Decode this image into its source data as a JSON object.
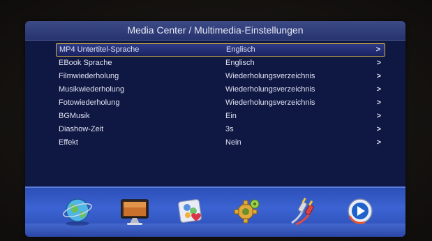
{
  "title": "Media Center / Multimedia-Einstellungen",
  "settings": [
    {
      "label": "MP4 Untertitel-Sprache",
      "value": "Englisch",
      "arrow": ">"
    },
    {
      "label": "EBook Sprache",
      "value": "Englisch",
      "arrow": ">"
    },
    {
      "label": "Filmwiederholung",
      "value": "Wiederholungsverzeichnis",
      "arrow": ">"
    },
    {
      "label": "Musikwiederholung",
      "value": "Wiederholungsverzeichnis",
      "arrow": ">"
    },
    {
      "label": "Fotowiederholung",
      "value": "Wiederholungsverzeichnis",
      "arrow": ">"
    },
    {
      "label": "BGMusik",
      "value": "Ein",
      "arrow": ">"
    },
    {
      "label": "Diashow-Zeit",
      "value": "3s",
      "arrow": ">"
    },
    {
      "label": "Effekt",
      "value": "Nein",
      "arrow": ">"
    }
  ],
  "dock": {
    "icons": [
      "globe-icon",
      "monitor-icon",
      "photos-icon",
      "settings-gear-icon",
      "cables-icon",
      "play-icon"
    ]
  },
  "colors": {
    "background": "#0f1743",
    "title_bar": "#2e3b78",
    "selection_border": "#d8b34a",
    "text": "#dfe3f2",
    "dock": "#3358c6"
  }
}
